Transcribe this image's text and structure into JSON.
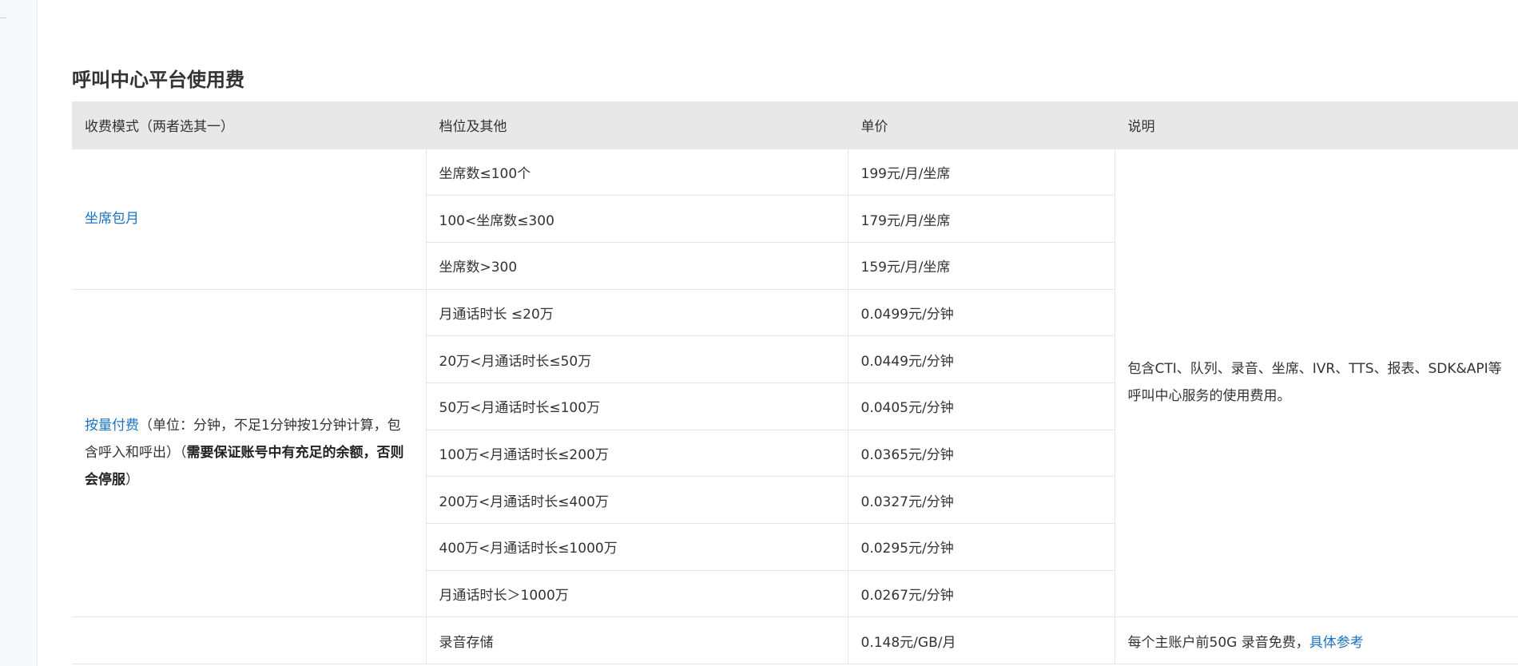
{
  "page": {
    "title": "呼叫中心平台使用费"
  },
  "table": {
    "headers": [
      "收费模式（两者选其一）",
      "档位及其他",
      "单价",
      "说明"
    ],
    "seat_monthly": {
      "mode_label": "坐席包月",
      "rows": [
        {
          "tier": "坐席数≤100个",
          "price": "199元/月/坐席"
        },
        {
          "tier": "100<坐席数≤300",
          "price": "179元/月/坐席"
        },
        {
          "tier": "坐席数>300",
          "price": "159元/月/坐席"
        }
      ]
    },
    "usage_based": {
      "mode_link": "按量付费",
      "mode_note": "（单位：分钟，不足1分钟按1分钟计算，包含呼入和呼出）（",
      "mode_bold": "需要保证账号中有充足的余额，否则会停服",
      "mode_end": "）",
      "rows": [
        {
          "tier": "月通话时长 ≤20万",
          "price": "0.0499元/分钟"
        },
        {
          "tier": "20万<月通话时长≤50万",
          "price": "0.0449元/分钟"
        },
        {
          "tier": "50万<月通话时长≤100万",
          "price": "0.0405元/分钟"
        },
        {
          "tier": "100万<月通话时长≤200万",
          "price": "0.0365元/分钟"
        },
        {
          "tier": "200万<月通话时长≤400万",
          "price": "0.0327元/分钟"
        },
        {
          "tier": "400万<月通话时长≤1000万",
          "price": "0.0295元/分钟"
        },
        {
          "tier": "月通话时长＞1000万",
          "price": "0.0267元/分钟"
        }
      ]
    },
    "shared_description": "包含CTI、队列、录音、坐席、IVR、TTS、报表、SDK&API等呼叫中心服务的使用费用。",
    "recording": {
      "tier": "录音存储",
      "price": "0.148元/GB/月",
      "desc_text": "每个主账户前50G 录音免费，",
      "desc_link": "具体参考"
    }
  }
}
